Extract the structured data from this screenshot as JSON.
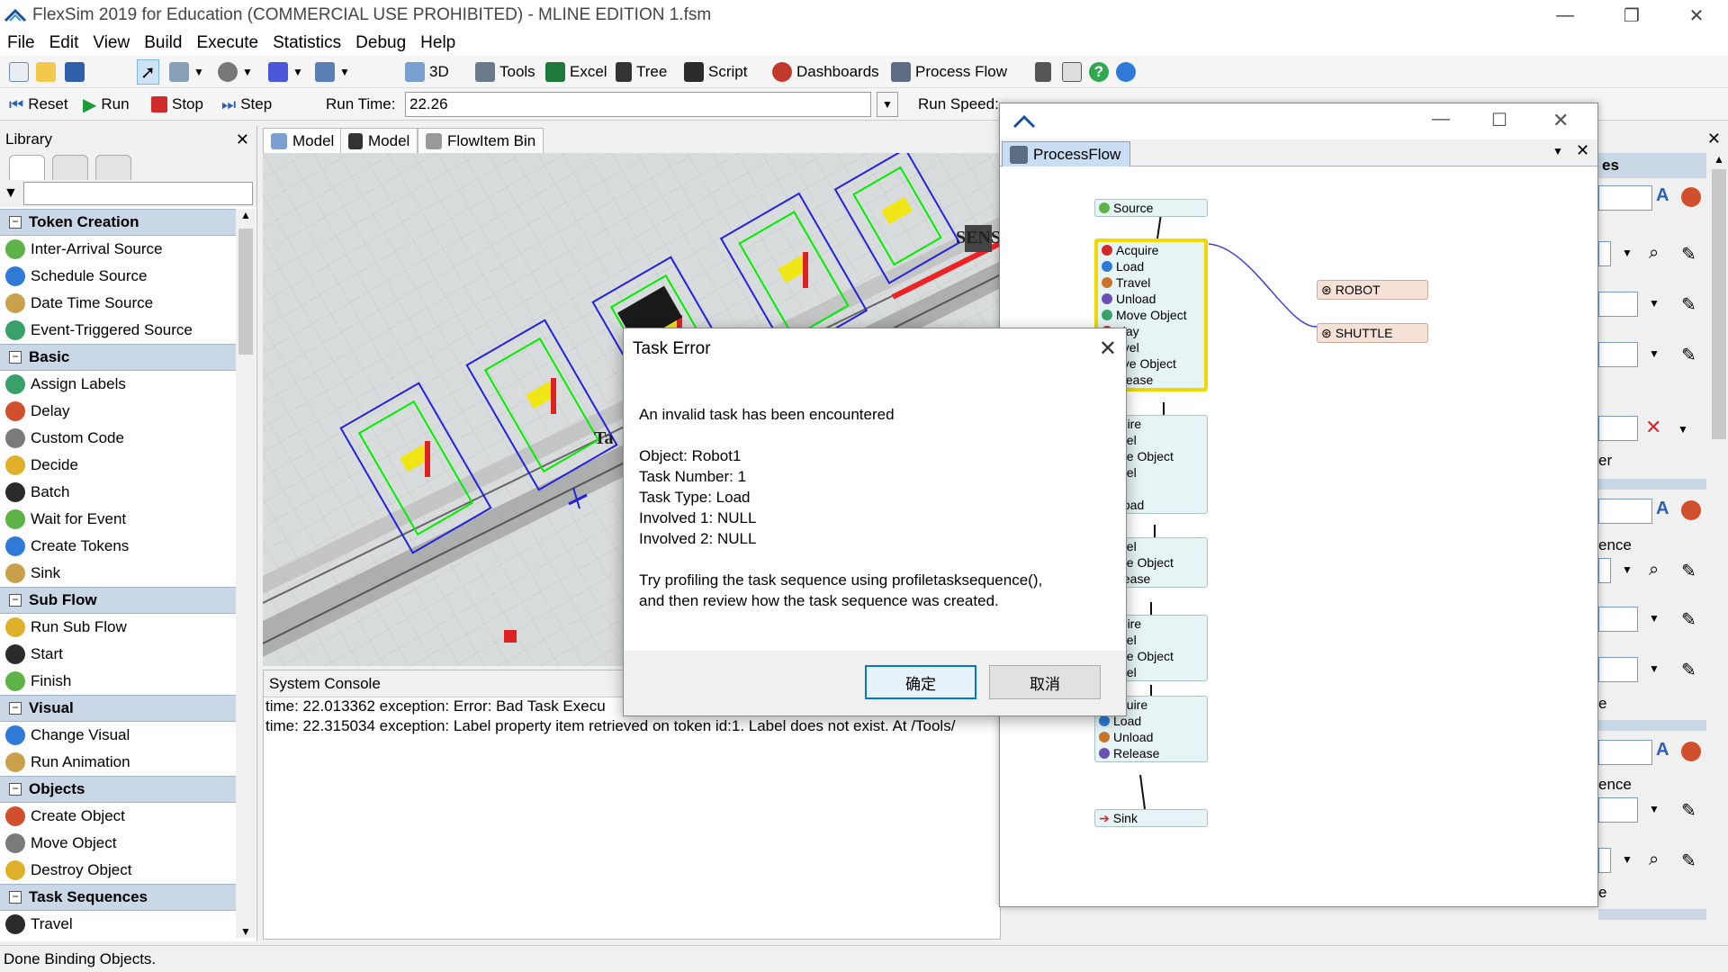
{
  "window": {
    "title": "FlexSim 2019 for Education (COMMERCIAL USE PROHIBITED) - MLINE EDITION 1.fsm"
  },
  "menu": [
    "File",
    "Edit",
    "View",
    "Build",
    "Execute",
    "Statistics",
    "Debug",
    "Help"
  ],
  "toolbar": {
    "btn_3d": "3D",
    "btn_tools": "Tools",
    "btn_excel": "Excel",
    "btn_tree": "Tree",
    "btn_script": "Script",
    "btn_dashboards": "Dashboards",
    "btn_processflow": "Process Flow"
  },
  "run_controls": {
    "reset": "Reset",
    "run": "Run",
    "stop": "Stop",
    "step": "Step",
    "run_time_label": "Run Time:",
    "run_time_value": "22.26",
    "run_speed_label": "Run Speed:"
  },
  "library": {
    "title": "Library",
    "categories": [
      {
        "label": "Token Creation",
        "items": [
          "Inter-Arrival Source",
          "Schedule Source",
          "Date Time Source",
          "Event-Triggered Source"
        ]
      },
      {
        "label": "Basic",
        "items": [
          "Assign Labels",
          "Delay",
          "Custom Code",
          "Decide",
          "Batch",
          "Wait for Event",
          "Create Tokens",
          "Sink"
        ]
      },
      {
        "label": "Sub Flow",
        "items": [
          "Run Sub Flow",
          "Start",
          "Finish"
        ]
      },
      {
        "label": "Visual",
        "items": [
          "Change Visual",
          "Run Animation"
        ]
      },
      {
        "label": "Objects",
        "items": [
          "Create Object",
          "Move Object",
          "Destroy Object"
        ]
      },
      {
        "label": "Task Sequences",
        "items": [
          "Travel"
        ]
      }
    ]
  },
  "model_tabs": [
    "Model",
    "Model",
    "FlowItem Bin"
  ],
  "model_view": {
    "label_sens": "SENS",
    "label_ta": "Ta"
  },
  "console": {
    "title": "System Console",
    "lines": [
      "time: 22.013362 exception: Error: Bad Task Execu",
      "time: 22.315034 exception: Label property item retrieved on token  id:1. Label does not exist. At /Tools/"
    ]
  },
  "process_flow": {
    "tab": "ProcessFlow",
    "source": "Source",
    "block1": [
      "Acquire",
      "Load",
      "Travel",
      "Unload",
      "Move Object",
      "elay",
      "avel",
      "ove Object",
      "elease"
    ],
    "block2": [
      "quire",
      "avel",
      "ove Object",
      "avel",
      "ad",
      "nload"
    ],
    "block3": [
      "avel",
      "ove Object",
      "elease"
    ],
    "block4": [
      "quire",
      "avel",
      "ove Object",
      "avel"
    ],
    "block5": [
      "cquire",
      "Load",
      "Unload",
      "Release"
    ],
    "sink": "Sink",
    "resources": [
      "ROBOT",
      "SHUTTLE"
    ]
  },
  "props": {
    "partial_labels": [
      "es",
      "er",
      "ence",
      "e",
      "ence",
      "e"
    ]
  },
  "dialog": {
    "title": "Task Error",
    "message": "An invalid task has been encountered",
    "details": [
      "Object: Robot1",
      "Task Number: 1",
      "Task Type: Load",
      "Involved 1: NULL",
      "Involved 2: NULL"
    ],
    "hint_1": "Try profiling the task sequence using profiletasksequence(),",
    "hint_2": "and then review how the task sequence was created.",
    "ok": "确定",
    "cancel": "取消"
  },
  "status": "Done Binding Objects."
}
